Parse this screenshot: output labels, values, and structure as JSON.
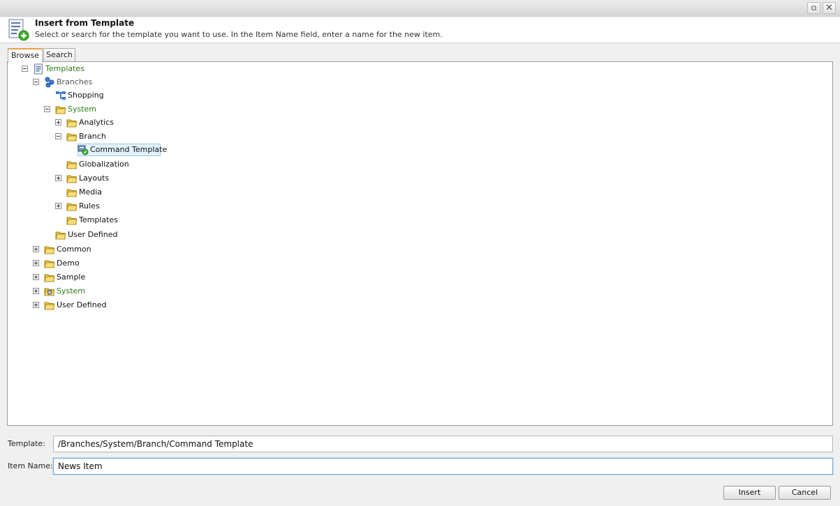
{
  "dialog": {
    "title": "Insert from Template",
    "description": "Select or search for the template you want to use. In the Item Name field, enter a name for the new item."
  },
  "tabs": {
    "browse": "Browse",
    "search": "Search"
  },
  "tree": [
    {
      "label": "Templates",
      "expander": "minus",
      "icon": "templates-icon",
      "color": "green"
    },
    {
      "label": "Branches",
      "expander": "minus",
      "icon": "branches-icon",
      "color": "gray"
    },
    {
      "label": "Shopping",
      "expander": "none",
      "icon": "branch-icon",
      "color": "black"
    },
    {
      "label": "System",
      "expander": "minus",
      "icon": "folder-icon",
      "color": "green"
    },
    {
      "label": "Analytics",
      "expander": "plus",
      "icon": "folder-icon",
      "color": "black"
    },
    {
      "label": "Branch",
      "expander": "minus",
      "icon": "folder-icon",
      "color": "black"
    },
    {
      "label": "Command Template",
      "expander": "none",
      "icon": "command-template-icon",
      "color": "black",
      "selected": true
    },
    {
      "label": "Globalization",
      "expander": "none",
      "icon": "folder-icon",
      "color": "black"
    },
    {
      "label": "Layouts",
      "expander": "plus",
      "icon": "folder-icon",
      "color": "black"
    },
    {
      "label": "Media",
      "expander": "none",
      "icon": "folder-icon",
      "color": "black"
    },
    {
      "label": "Rules",
      "expander": "plus",
      "icon": "folder-icon",
      "color": "black"
    },
    {
      "label": "Templates",
      "expander": "none",
      "icon": "folder-icon",
      "color": "black"
    },
    {
      "label": "User Defined",
      "expander": "none",
      "icon": "folder-icon",
      "color": "black"
    },
    {
      "label": "Common",
      "expander": "plus",
      "icon": "folder-icon",
      "color": "black"
    },
    {
      "label": "Demo",
      "expander": "plus",
      "icon": "folder-icon",
      "color": "black"
    },
    {
      "label": "Sample",
      "expander": "plus",
      "icon": "folder-icon",
      "color": "black"
    },
    {
      "label": "System",
      "expander": "plus",
      "icon": "system-folder-icon",
      "color": "green"
    },
    {
      "label": "User Defined",
      "expander": "plus",
      "icon": "folder-icon",
      "color": "black"
    }
  ],
  "form": {
    "template_label": "Template:",
    "template_value": "/Branches/System/Branch/Command Template",
    "item_name_label": "Item Name:",
    "item_name_value": "News Item"
  },
  "buttons": {
    "insert": "Insert",
    "cancel": "Cancel"
  },
  "colors": {
    "green_label": "#2a7a16",
    "selection_bg": "#e4f2fc",
    "selection_border": "#99c8ea",
    "active_tab_accent": "#e8a33d"
  }
}
